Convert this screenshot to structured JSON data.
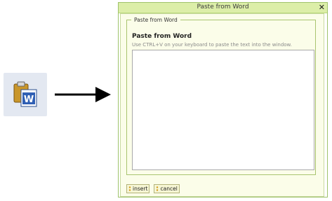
{
  "dialog": {
    "title": "Paste from Word",
    "close_glyph": "✕",
    "fieldset_legend": "Paste from Word",
    "heading": "Paste from Word",
    "hint": "Use CTRL+V on your keyboard to paste the text into the window.",
    "textarea_value": ""
  },
  "buttons": {
    "insert_label": "insert",
    "cancel_label": "cancel"
  },
  "toolbar": {
    "icon": "paste-from-word-icon"
  },
  "colors": {
    "titlebar": "#dceea8",
    "dialog_border": "#9fc36b",
    "content_bg": "#fbfde9"
  }
}
